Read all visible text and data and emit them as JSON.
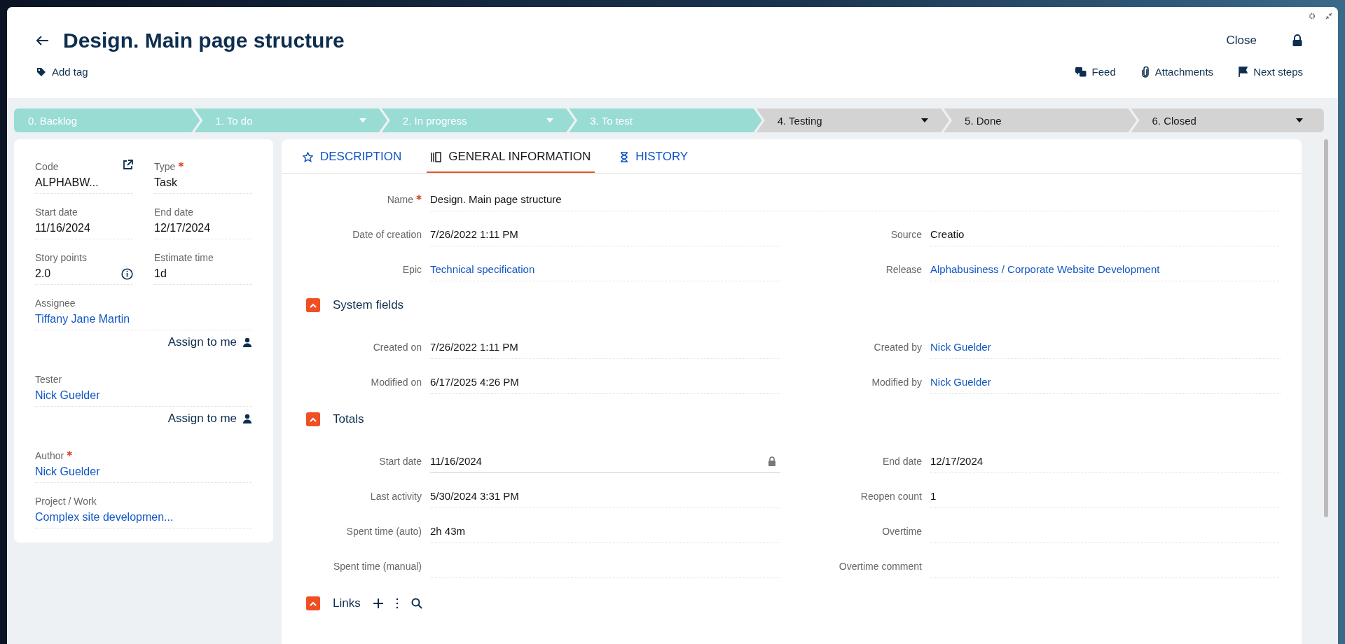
{
  "header": {
    "title": "Design. Main page structure",
    "close_label": "Close",
    "add_tag": "Add tag",
    "actions": [
      {
        "label": "Feed",
        "kind": "feed"
      },
      {
        "label": "Attachments",
        "kind": "attachment"
      },
      {
        "label": "Next steps",
        "kind": "flag"
      }
    ]
  },
  "stages": [
    {
      "label": "0. Backlog",
      "done": true,
      "menu": false
    },
    {
      "label": "1. To do",
      "done": true,
      "menu": true
    },
    {
      "label": "2. In progress",
      "done": true,
      "menu": true
    },
    {
      "label": "3. To test",
      "done": true,
      "menu": false
    },
    {
      "label": "4. Testing",
      "done": false,
      "menu": true
    },
    {
      "label": "5. Done",
      "done": false,
      "menu": false
    },
    {
      "label": "6. Closed",
      "done": false,
      "menu": true
    }
  ],
  "side_rows": [
    [
      {
        "kind": "external",
        "label": "Code",
        "value": "ALPHABW...",
        "link": false,
        "required": false
      },
      {
        "kind": "plain",
        "label": "Type",
        "value": "Task",
        "link": false,
        "required": true
      }
    ],
    [
      {
        "kind": "plain",
        "label": "Start date",
        "value": "11/16/2024",
        "link": false,
        "required": false
      },
      {
        "kind": "plain",
        "label": "End date",
        "value": "12/17/2024",
        "link": false,
        "required": false
      }
    ],
    [
      {
        "kind": "info",
        "label": "Story points",
        "value": "2.0",
        "link": false,
        "required": false
      },
      {
        "kind": "plain",
        "label": "Estimate time",
        "value": "1d",
        "link": false,
        "required": false
      }
    ],
    [
      {
        "kind": "plain",
        "label": "Assignee",
        "value": "Tiffany Jane Martin",
        "link": true,
        "required": false,
        "assign": "Assign to me"
      }
    ],
    [
      {
        "kind": "plain",
        "label": "Tester",
        "value": "Nick Guelder",
        "link": true,
        "required": false,
        "assign": "Assign to me"
      }
    ],
    [
      {
        "kind": "plain",
        "label": "Author",
        "value": "Nick Guelder",
        "link": true,
        "required": true
      }
    ],
    [
      {
        "kind": "plain",
        "label": "Project / Work",
        "value": "Complex site developmen...",
        "link": true,
        "required": false
      }
    ]
  ],
  "tabs": [
    {
      "label": "DESCRIPTION",
      "kind": "star",
      "selected": false
    },
    {
      "label": "GENERAL INFORMATION",
      "kind": "book",
      "selected": true
    },
    {
      "label": "HISTORY",
      "kind": "hourglass",
      "selected": false
    }
  ],
  "sections": [
    {
      "rows": [
        [
          {
            "label": "Name",
            "value": "Design. Main page structure",
            "required": true,
            "link": false,
            "locked": false
          }
        ],
        [
          {
            "label": "Date of creation",
            "value": "7/26/2022 1:11 PM",
            "required": false,
            "link": false,
            "locked": false
          },
          {
            "label": "Source",
            "value": "Creatio",
            "required": false,
            "link": false,
            "locked": false
          }
        ],
        [
          {
            "label": "Epic",
            "value": "Technical specification",
            "required": false,
            "link": true,
            "locked": false
          },
          {
            "label": "Release",
            "value": "Alphabusiness / Corporate Website Development",
            "required": false,
            "link": true,
            "locked": false
          }
        ]
      ]
    },
    {
      "title": "System fields",
      "expanded": true,
      "rows": [
        [
          {
            "label": "Created on",
            "value": "7/26/2022 1:11 PM",
            "required": false,
            "link": false,
            "locked": false
          },
          {
            "label": "Created by",
            "value": "Nick Guelder",
            "required": false,
            "link": true,
            "locked": false
          }
        ],
        [
          {
            "label": "Modified on",
            "value": "6/17/2025 4:26 PM",
            "required": false,
            "link": false,
            "locked": false
          },
          {
            "label": "Modified by",
            "value": "Nick Guelder",
            "required": false,
            "link": true,
            "locked": false
          }
        ]
      ]
    },
    {
      "title": "Totals",
      "expanded": true,
      "rows": [
        [
          {
            "label": "Start date",
            "value": "11/16/2024",
            "required": false,
            "link": false,
            "locked": true
          },
          {
            "label": "End date",
            "value": "12/17/2024",
            "required": false,
            "link": false,
            "locked": false
          }
        ],
        [
          {
            "label": "Last activity",
            "value": "5/30/2024 3:31 PM",
            "required": false,
            "link": false,
            "locked": false
          },
          {
            "label": "Reopen count",
            "value": "1",
            "required": false,
            "link": false,
            "locked": false
          }
        ],
        [
          {
            "label": "Spent time (auto)",
            "value": "2h 43m",
            "required": false,
            "link": false,
            "locked": false
          },
          {
            "label": "Overtime",
            "required": false,
            "locked": false
          }
        ],
        [
          {
            "label": "Spent time (manual)",
            "required": false,
            "locked": false
          },
          {
            "label": "Overtime comment",
            "required": false,
            "locked": false
          }
        ]
      ]
    },
    {
      "title": "Links",
      "expanded": true,
      "tools": [
        {
          "kind": "add"
        },
        {
          "kind": "more"
        },
        {
          "kind": "search"
        }
      ]
    }
  ]
}
